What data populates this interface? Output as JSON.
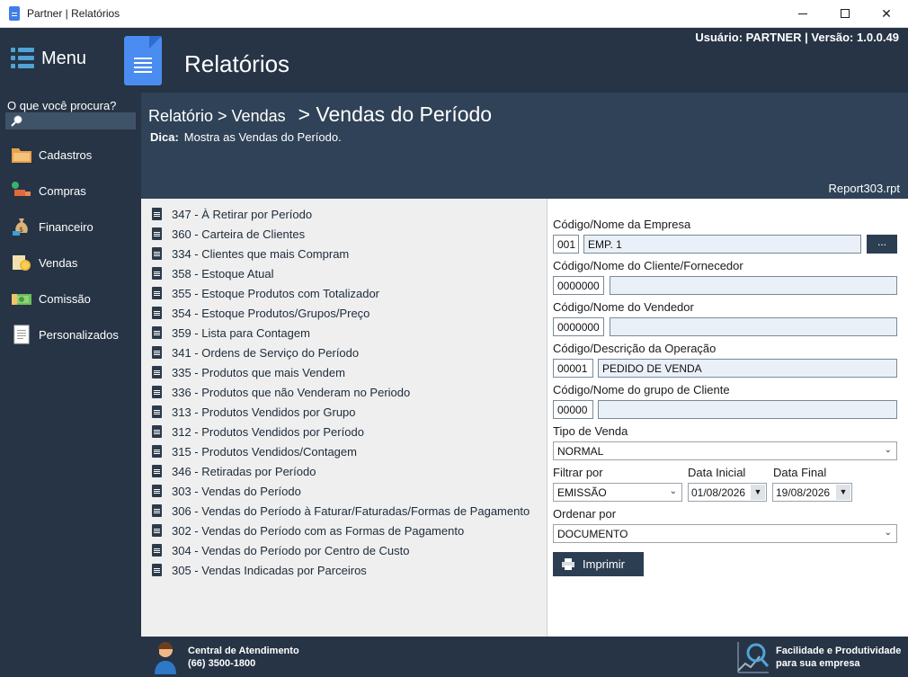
{
  "window": {
    "title": "Partner | Relatórios",
    "minimize_glyph": "",
    "maximize_glyph": "",
    "close_glyph": "✕"
  },
  "header": {
    "menu_label": "Menu",
    "title": "Relatórios",
    "user_info": "Usuário: PARTNER | Versão: 1.0.0.49"
  },
  "sidebar": {
    "search_label": "O que você procura?",
    "search_value": "",
    "items": [
      {
        "label": "Cadastros",
        "icon": "folder-icon"
      },
      {
        "label": "Compras",
        "icon": "delivery-truck-icon"
      },
      {
        "label": "Financeiro",
        "icon": "money-bag-icon"
      },
      {
        "label": "Vendas",
        "icon": "coins-icon"
      },
      {
        "label": "Comissão",
        "icon": "cash-icon"
      },
      {
        "label": "Personalizados",
        "icon": "document-icon"
      }
    ]
  },
  "content": {
    "breadcrumb": "Relatório > Vendas",
    "current": "> Vendas do Período",
    "dica_label": "Dica:",
    "dica_text": "Mostra as Vendas do Período.",
    "report_file": "Report303.rpt"
  },
  "reports": [
    "347 - À Retirar por Período",
    "360 - Carteira de Clientes",
    "334 - Clientes que mais Compram",
    "358 - Estoque Atual",
    "355 - Estoque Produtos com Totalizador",
    "354 - Estoque Produtos/Grupos/Preço",
    "359 - Lista para Contagem",
    "341 - Ordens de Serviço do Período",
    "335 - Produtos que mais Vendem",
    "336 - Produtos que não Venderam no Periodo",
    "313 - Produtos Vendidos por Grupo",
    "312 - Produtos Vendidos por Período",
    "315 - Produtos Vendidos/Contagem",
    "346 - Retiradas por Período",
    "303 - Vendas do Período",
    "306 - Vendas do Período à Faturar/Faturadas/Formas de Pagamento",
    "302 - Vendas do Período com as Formas de Pagamento",
    "304 - Vendas do Período por Centro de Custo",
    "305 - Vendas Indicadas por Parceiros"
  ],
  "form": {
    "empresa_label": "Código/Nome da Empresa",
    "empresa_code": "001",
    "empresa_name": "EMP. 1",
    "empresa_btn": "...",
    "cliente_label": "Código/Nome do Cliente/Fornecedor",
    "cliente_code": "0000000",
    "cliente_name": "",
    "vendedor_label": "Código/Nome do Vendedor",
    "vendedor_code": "0000000",
    "vendedor_name": "",
    "operacao_label": "Código/Descrição da Operação",
    "operacao_code": "00001",
    "operacao_name": "PEDIDO DE VENDA",
    "grupo_label": "Código/Nome do grupo de Cliente",
    "grupo_code": "00000",
    "grupo_name": "",
    "tipo_label": "Tipo de Venda",
    "tipo_value": "NORMAL",
    "filtrar_label": "Filtrar por",
    "filtrar_value": "EMISSÃO",
    "data_inicial_label": "Data Inicial",
    "data_inicial": "01/08/2026",
    "data_final_label": "Data Final",
    "data_final": "19/08/2026",
    "ordenar_label": "Ordenar por",
    "ordenar_value": "DOCUMENTO",
    "print_label": "Imprimir"
  },
  "footer": {
    "support_title": "Central de Atendimento",
    "support_phone": "(66) 3500-1800",
    "tagline_1": "Facilidade e Produtividade",
    "tagline_2": "para sua empresa"
  }
}
